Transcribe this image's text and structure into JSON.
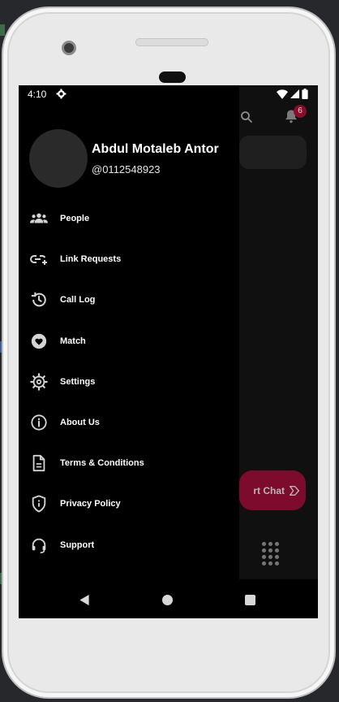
{
  "status_bar": {
    "time": "4:10",
    "icons": [
      "gear-icon",
      "wifi-icon",
      "signal-icon",
      "battery-icon"
    ]
  },
  "background_app": {
    "notification_count": "6",
    "start_chat_label": "rt Chat",
    "icons": [
      "search-icon",
      "bell-icon",
      "send-icon",
      "dialpad-icon"
    ]
  },
  "drawer": {
    "profile": {
      "name": "Abdul Motaleb Antor",
      "handle": "@0112548923"
    },
    "items": [
      {
        "label": "People",
        "icon": "people-icon"
      },
      {
        "label": "Link Requests",
        "icon": "link-add-icon"
      },
      {
        "label": "Call Log",
        "icon": "history-icon"
      },
      {
        "label": "Match",
        "icon": "heart-icon"
      },
      {
        "label": "Settings",
        "icon": "settings-icon"
      },
      {
        "label": "About Us",
        "icon": "info-icon"
      },
      {
        "label": "Terms & Conditions",
        "icon": "document-icon"
      },
      {
        "label": "Privacy Policy",
        "icon": "shield-icon"
      },
      {
        "label": "Support",
        "icon": "headset-icon"
      }
    ]
  },
  "navigation": {
    "icons": [
      "back-icon",
      "home-icon",
      "recents-icon"
    ]
  },
  "colors": {
    "accent": "#7c0b2e",
    "badge": "#8b0b2b",
    "drawer_bg": "#000000"
  }
}
